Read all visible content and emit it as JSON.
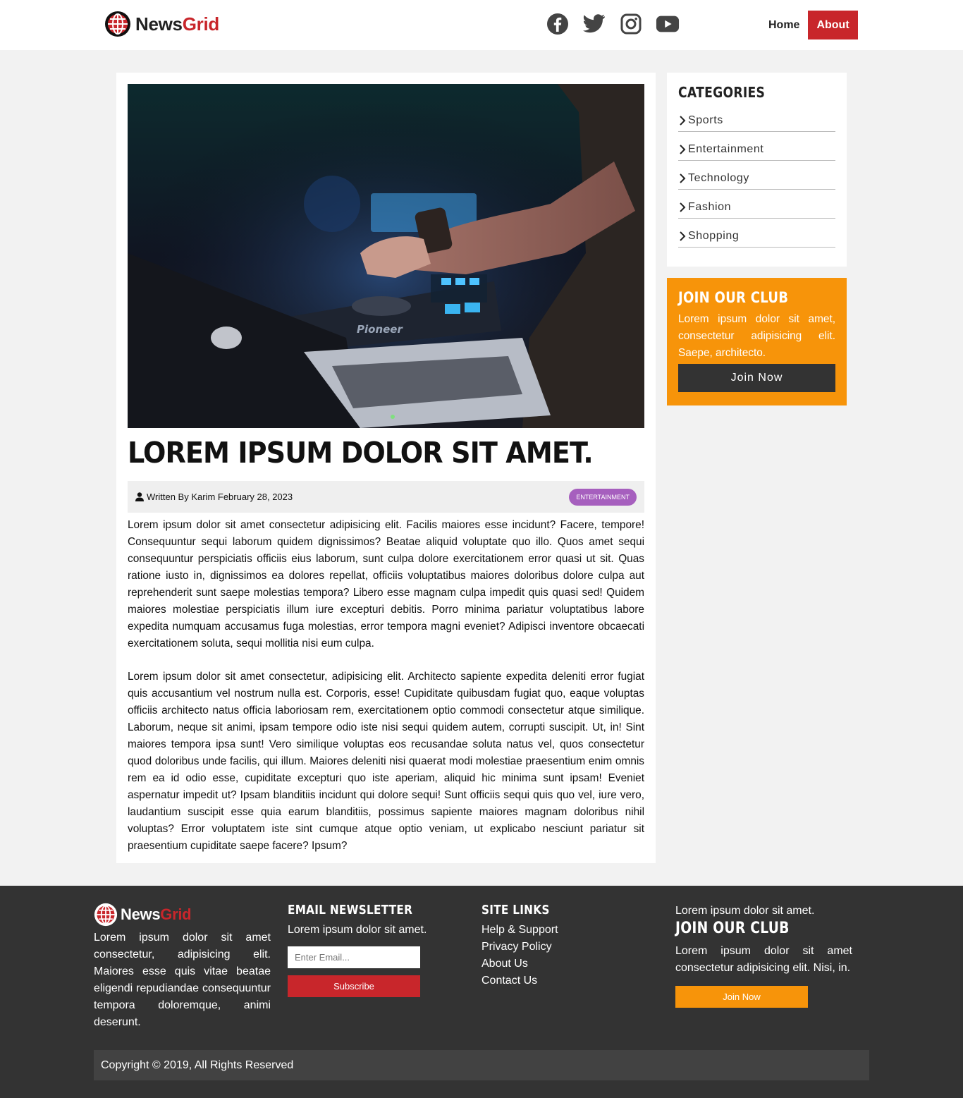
{
  "brand": {
    "part1": "News",
    "part2": "Grid",
    "accent": "#c8262b"
  },
  "header": {
    "social": [
      {
        "icon": "facebook-icon"
      },
      {
        "icon": "twitter-icon"
      },
      {
        "icon": "instagram-icon"
      },
      {
        "icon": "youtube-icon"
      }
    ],
    "nav": {
      "home": "Home",
      "about": "About"
    }
  },
  "article": {
    "title": "LOREM IPSUM DOLOR SIT AMET.",
    "meta": {
      "byline": "Written By Karim February 28, 2023",
      "category": "ENTERTAINMENT"
    },
    "paragraphs": [
      "Lorem ipsum dolor sit amet consectetur adipisicing elit. Facilis maiores esse incidunt? Facere, tempore! Consequuntur sequi laborum quidem dignissimos? Beatae aliquid voluptate quo illo. Quos amet sequi consequuntur perspiciatis officiis eius laborum, sunt culpa dolore exercitationem error quasi ut sit. Quas ratione iusto in, dignissimos ea dolores repellat, officiis voluptatibus maiores doloribus dolore culpa aut reprehenderit sunt saepe molestias tempora? Libero esse magnam culpa impedit quis quasi sed! Quidem maiores molestiae perspiciatis illum iure excepturi debitis. Porro minima pariatur voluptatibus labore expedita numquam accusamus fuga molestias, error tempora magni eveniet? Adipisci inventore obcaecati exercitationem soluta, sequi mollitia nisi eum culpa.",
      "Lorem ipsum dolor sit amet consectetur, adipisicing elit. Architecto sapiente expedita deleniti error fugiat quis accusantium vel nostrum nulla est. Corporis, esse! Cupiditate quibusdam fugiat quo, eaque voluptas officiis architecto natus officia laboriosam rem, exercitationem optio commodi consectetur atque similique. Laborum, neque sit animi, ipsam tempore odio iste nisi sequi quidem autem, corrupti suscipit. Ut, in! Sint maiores tempora ipsa sunt! Vero similique voluptas eos recusandae soluta natus vel, quos consectetur quod doloribus unde facilis, qui illum. Maiores deleniti nisi quaerat modi molestiae praesentium enim omnis rem ea id odio esse, cupiditate excepturi quo iste aperiam, aliquid hic minima sunt ipsam! Eveniet aspernatur impedit ut? Ipsam blanditiis incidunt qui dolore sequi! Sunt officiis sequi quis quo vel, iure vero, laudantium suscipit esse quia earum blanditiis, possimus sapiente maiores magnam doloribus nihil voluptas? Error voluptatem iste sint cumque atque optio veniam, ut explicabo nesciunt pariatur sit praesentium cupiditate saepe facere? Ipsum?"
    ]
  },
  "sidebar": {
    "categories": {
      "heading": "CATEGORIES",
      "items": [
        "Sports",
        "Entertainment",
        "Technology",
        "Fashion",
        "Shopping"
      ]
    },
    "club": {
      "heading": "JOIN OUR CLUB",
      "text": "Lorem ipsum dolor sit amet, consectetur adipisicing elit. Saepe, architecto.",
      "button": "Join Now",
      "color": "#f7940a"
    }
  },
  "footer": {
    "about": "Lorem ipsum dolor sit amet consectetur, adipisicing elit. Maiores esse quis vitae beatae eligendi repudiandae consequuntur tempora doloremque, animi deserunt.",
    "newsletter": {
      "heading": "EMAIL NEWSLETTER",
      "text": "Lorem ipsum dolor sit amet.",
      "placeholder": "Enter Email...",
      "button": "Subscribe"
    },
    "links": {
      "heading": "SITE LINKS",
      "items": [
        "Help & Support",
        "Privacy Policy",
        "About Us",
        "Contact Us"
      ]
    },
    "club": {
      "intro": "Lorem ipsum dolor sit amet.",
      "heading": "JOIN OUR CLUB",
      "text": "Lorem ipsum dolor sit amet consectetur adipisicing elit. Nisi, in.",
      "button": "Join Now"
    },
    "copyright": "Copyright © 2019, All Rights Reserved"
  }
}
